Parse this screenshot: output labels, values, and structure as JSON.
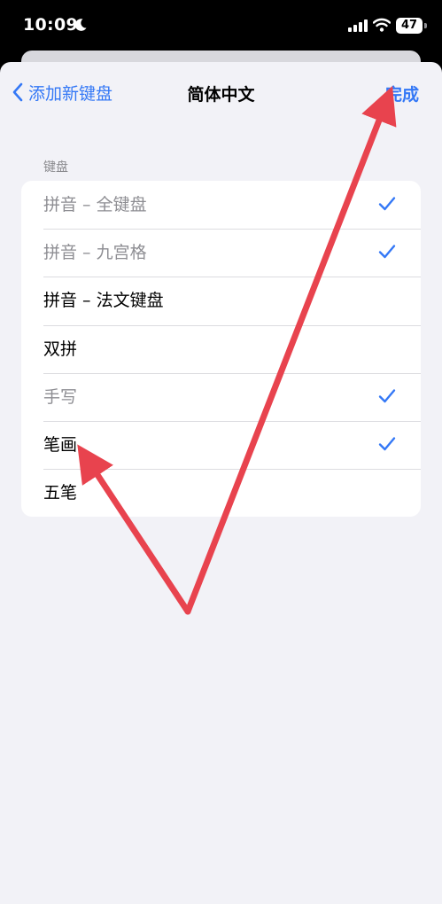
{
  "status_bar": {
    "time": "10:09",
    "battery": "47"
  },
  "nav": {
    "back_label": "添加新键盘",
    "title": "简体中文",
    "done_label": "完成"
  },
  "section": {
    "header": "键盘"
  },
  "keyboards": [
    {
      "label": "拼音 – 全键盘",
      "checked": true
    },
    {
      "label": "拼音 – 九宫格",
      "checked": true
    },
    {
      "label": "拼音 – 法文键盘",
      "checked": false
    },
    {
      "label": "双拼",
      "checked": false
    },
    {
      "label": "手写",
      "checked": true
    },
    {
      "label": "笔画",
      "checked": true
    },
    {
      "label": "五笔",
      "checked": false
    }
  ],
  "colors": {
    "accent": "#3478f6",
    "annotation": "#e8434e",
    "background": "#f2f2f7"
  }
}
